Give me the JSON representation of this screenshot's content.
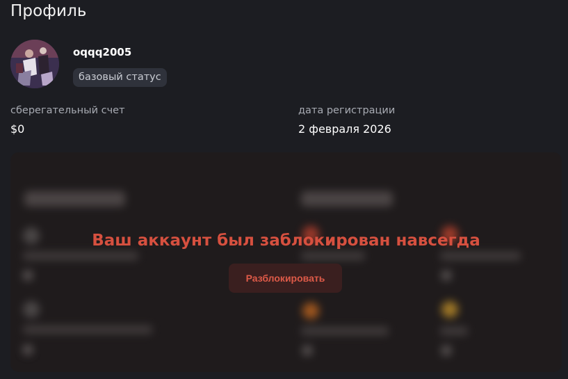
{
  "page": {
    "title": "Профиль"
  },
  "profile": {
    "username": "oqqq2005",
    "status_badge": "базовый статус",
    "avatar_icon": "avatar-photo"
  },
  "stats": [
    {
      "label": "сберегательный счет",
      "value": "$0"
    },
    {
      "label": "дата регистрации",
      "value": "2 февраля 2026"
    }
  ],
  "ban_panel": {
    "message": "Ваш аккаунт был заблокирован навсегда",
    "unblock_label": "Разблокировать",
    "accent_color": "#d6503f"
  }
}
